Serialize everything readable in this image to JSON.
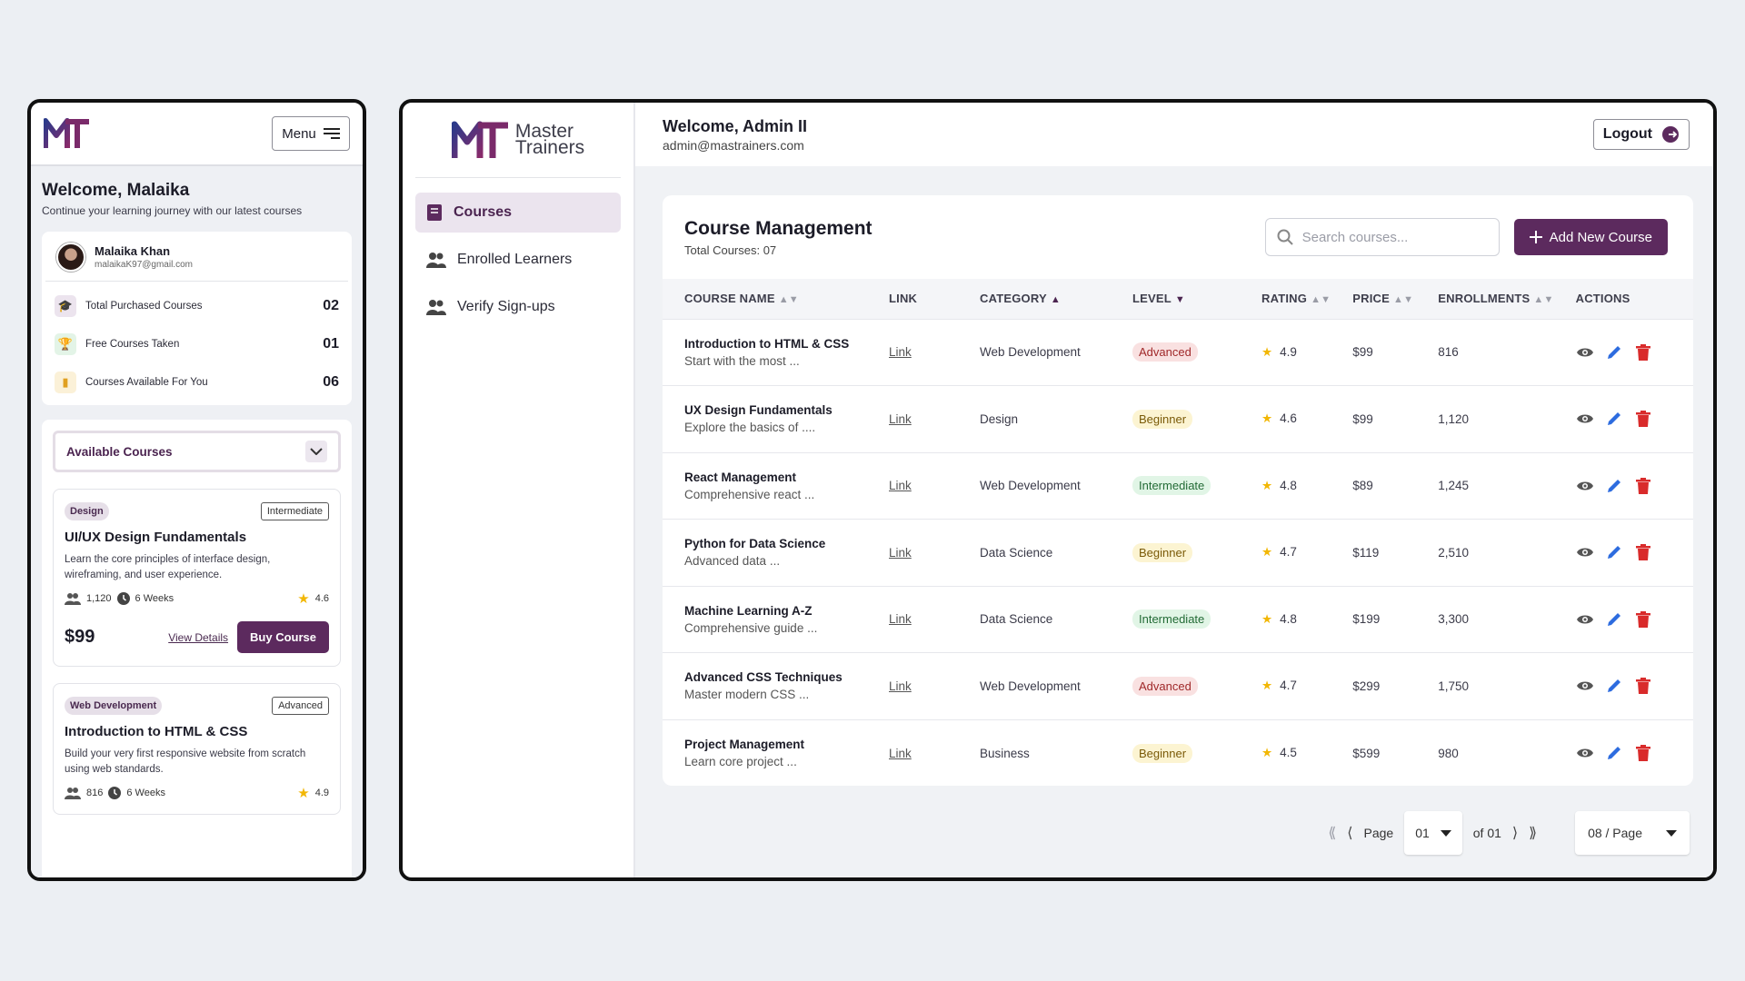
{
  "mobile": {
    "menu_label": "Menu",
    "welcome": "Welcome, Malaika",
    "subtitle": "Continue your learning journey with our latest courses",
    "profile": {
      "name": "Malaika Khan",
      "email": "malaikaK97@gmail.com"
    },
    "stats": [
      {
        "label": "Total Purchased Courses",
        "value": "02",
        "icon": "graduation-cap-icon",
        "color": "#7a4a80",
        "bg": "#ece4ee"
      },
      {
        "label": "Free Courses Taken",
        "value": "01",
        "icon": "trophy-icon",
        "color": "#2e9a4a",
        "bg": "#e3f4e7"
      },
      {
        "label": "Courses Available For You",
        "value": "06",
        "icon": "book-icon",
        "color": "#e0a020",
        "bg": "#fbf1d8"
      }
    ],
    "available_label": "Available Courses",
    "courses": [
      {
        "category": "Design",
        "level": "Intermediate",
        "title": "UI/UX Design Fundamentals",
        "desc": "Learn the core principles of interface design, wireframing, and user experience.",
        "learners": "1,120",
        "duration": "6 Weeks",
        "rating": "4.6",
        "price": "$99",
        "view": "View Details",
        "buy": "Buy Course"
      },
      {
        "category": "Web Development",
        "level": "Advanced",
        "title": "Introduction to HTML & CSS",
        "desc": "Build your very first responsive website from scratch using web standards.",
        "learners": "816",
        "duration": "6 Weeks",
        "rating": "4.9"
      }
    ]
  },
  "desktop": {
    "brand": {
      "line1": "Master",
      "line2": "Trainers"
    },
    "nav": [
      {
        "label": "Courses",
        "icon": "book-icon",
        "active": true
      },
      {
        "label": "Enrolled Learners",
        "icon": "users-icon",
        "active": false
      },
      {
        "label": "Verify Sign-ups",
        "icon": "users-icon",
        "active": false
      }
    ],
    "welcome": "Welcome, Admin II",
    "email": "admin@mastrainers.com",
    "logout": "Logout",
    "panel": {
      "title": "Course Management",
      "subtitle": "Total Courses: 07",
      "search_placeholder": "Search courses...",
      "add_label": "Add New Course"
    },
    "columns": [
      "COURSE NAME",
      "LINK",
      "CATEGORY",
      "LEVEL",
      "RATING",
      "PRICE",
      "ENROLLMENTS",
      "ACTIONS"
    ],
    "rows": [
      {
        "name": "Introduction to HTML & CSS",
        "desc": "Start with the most ...",
        "link": "Link",
        "category": "Web Development",
        "level": "Advanced",
        "rating": "4.9",
        "price": "$99",
        "enrollments": "816"
      },
      {
        "name": "UX Design Fundamentals",
        "desc": "Explore the basics of ....",
        "link": "Link",
        "category": "Design",
        "level": "Beginner",
        "rating": "4.6",
        "price": "$99",
        "enrollments": "1,120"
      },
      {
        "name": "React Management",
        "desc": "Comprehensive react ...",
        "link": "Link",
        "category": "Web Development",
        "level": "Intermediate",
        "rating": "4.8",
        "price": "$89",
        "enrollments": "1,245"
      },
      {
        "name": "Python for Data Science",
        "desc": "Advanced data ...",
        "link": "Link",
        "category": "Data Science",
        "level": "Beginner",
        "rating": "4.7",
        "price": "$119",
        "enrollments": "2,510"
      },
      {
        "name": "Machine Learning A-Z",
        "desc": "Comprehensive guide ...",
        "link": "Link",
        "category": "Data Science",
        "level": "Intermediate",
        "rating": "4.8",
        "price": "$199",
        "enrollments": "3,300"
      },
      {
        "name": "Advanced CSS Techniques",
        "desc": "Master modern CSS ...",
        "link": "Link",
        "category": "Web Development",
        "level": "Advanced",
        "rating": "4.7",
        "price": "$299",
        "enrollments": "1,750"
      },
      {
        "name": "Project Management",
        "desc": "Learn core project ...",
        "link": "Link",
        "category": "Business",
        "level": "Beginner",
        "rating": "4.5",
        "price": "$599",
        "enrollments": "980"
      }
    ],
    "pagination": {
      "page_label": "Page",
      "page": "01",
      "of": "of 01",
      "per_page": "08 / Page"
    },
    "colors": {
      "brand": "#5c2a5e",
      "advanced": "#a0292a",
      "beginner": "#7a5a08",
      "intermediate": "#236b36",
      "view": "#555555",
      "edit": "#2d6cdf",
      "delete": "#d92b2b"
    }
  }
}
